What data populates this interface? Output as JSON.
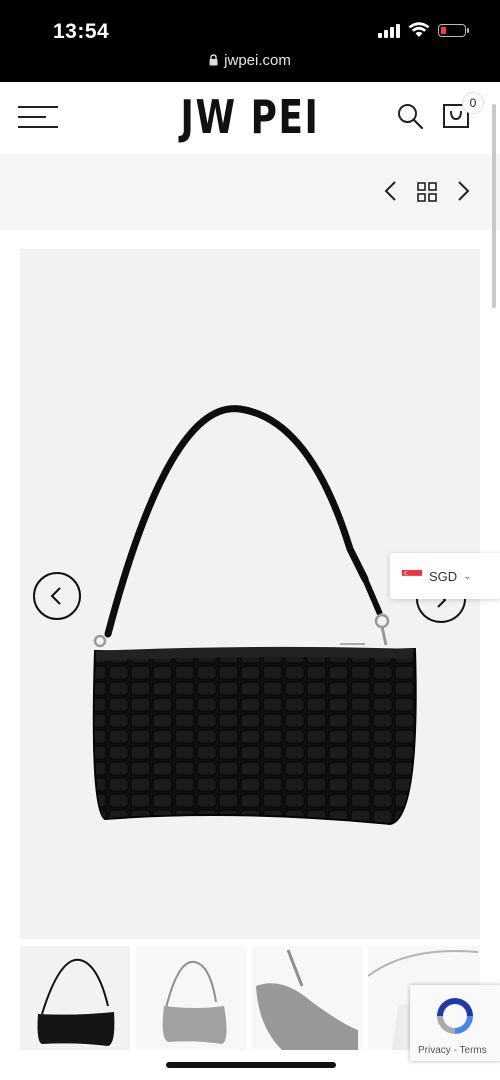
{
  "status_bar": {
    "time": "13:54",
    "url": "jwpei.com",
    "battery_color": "#ff3b30"
  },
  "header": {
    "logo": "JW PEI",
    "cart_count": "0",
    "icons": [
      "menu-icon",
      "search-icon",
      "cart-icon"
    ]
  },
  "product_nav": {
    "icons": [
      "chevron-left-icon",
      "grid-icon",
      "chevron-right-icon"
    ]
  },
  "gallery": {
    "currency_code": "SGD",
    "currency_flag": "singapore-flag-icon",
    "thumbnail_count": 4,
    "active_thumbnail": 1
  },
  "recaptcha": {
    "privacy": "Privacy",
    "separator": "-",
    "terms": "Terms"
  },
  "colors": {
    "bag": "#0d0d0d",
    "page_bg": "#ffffff",
    "gallery_bg": "#f2f2f2",
    "strip_bg": "#f6f6f6",
    "flag_red": "#ef3340"
  }
}
